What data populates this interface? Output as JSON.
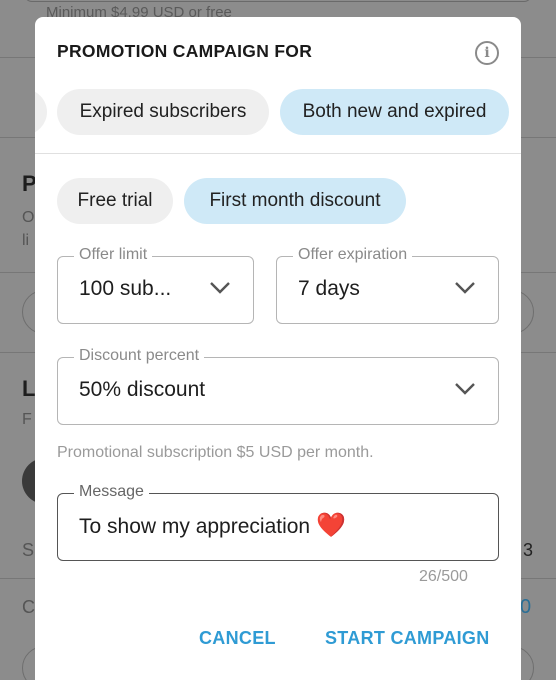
{
  "background": {
    "top_field_text": "Minimum $4.99 USD or free",
    "letter_p": "P",
    "letter_o": "O",
    "letter_li": "li",
    "letter_l": "L",
    "letter_f": "F",
    "letter_s": "S",
    "letter_c": "C",
    "right_number": "3",
    "right_blue": "0"
  },
  "modal": {
    "title": "PROMOTION CAMPAIGN FOR",
    "audience_chips": [
      {
        "label": "Expired subscribers",
        "selected": false
      },
      {
        "label": "Both new and expired",
        "selected": true
      }
    ],
    "offer_chips": [
      {
        "label": "Free trial",
        "selected": false
      },
      {
        "label": "First month discount",
        "selected": true
      }
    ],
    "offer_limit": {
      "label": "Offer limit",
      "value": "100 sub..."
    },
    "offer_expiration": {
      "label": "Offer expiration",
      "value": "7 days"
    },
    "discount_percent": {
      "label": "Discount percent",
      "value": "50% discount"
    },
    "helper_text": "Promotional subscription $5 USD per month.",
    "message": {
      "label": "Message",
      "value": "To show my appreciation",
      "emoji": "❤️"
    },
    "char_counter": "26/500",
    "cancel_label": "CANCEL",
    "start_label": "START CAMPAIGN"
  },
  "colors": {
    "accent": "#2f9bd4",
    "chip_selected": "#cfe9f7",
    "chip_default": "#efefef",
    "overlay": "#8c8c8c"
  }
}
